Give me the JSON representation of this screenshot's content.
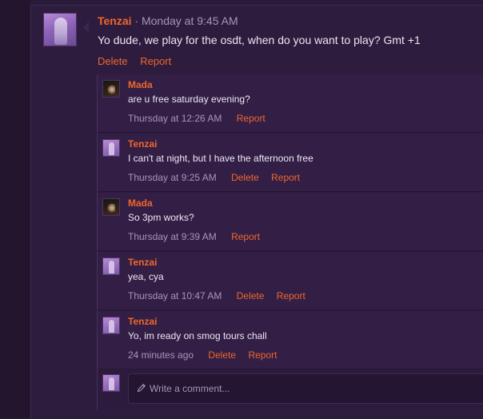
{
  "post": {
    "author": "Tenzai",
    "timestamp": "Monday at 9:45 AM",
    "body": "Yo dude, we play for the osdt, when do you want to play? Gmt +1",
    "actions": {
      "delete": "Delete",
      "report": "Report"
    }
  },
  "comments": [
    {
      "author": "Mada",
      "text": "are u free saturday evening?",
      "time": "Thursday at 12:26 AM",
      "delete": "",
      "report": "Report"
    },
    {
      "author": "Tenzai",
      "text": "I can't at night, but I have the afternoon free",
      "time": "Thursday at 9:25 AM",
      "delete": "Delete",
      "report": "Report"
    },
    {
      "author": "Mada",
      "text": "So 3pm works?",
      "time": "Thursday at 9:39 AM",
      "delete": "",
      "report": "Report"
    },
    {
      "author": "Tenzai",
      "text": "yea, cya",
      "time": "Thursday at 10:47 AM",
      "delete": "Delete",
      "report": "Report"
    },
    {
      "author": "Tenzai",
      "text": "Yo, im ready on smog tours chall",
      "time": "24 minutes ago",
      "delete": "Delete",
      "report": "Report"
    }
  ],
  "composer": {
    "placeholder": "Write a comment..."
  },
  "colors": {
    "accent": "#f0662a",
    "background": "#2e1c3e",
    "comment_bg": "#331f46",
    "muted": "#a497b4"
  },
  "icons": {
    "composer": "pencil-icon"
  }
}
